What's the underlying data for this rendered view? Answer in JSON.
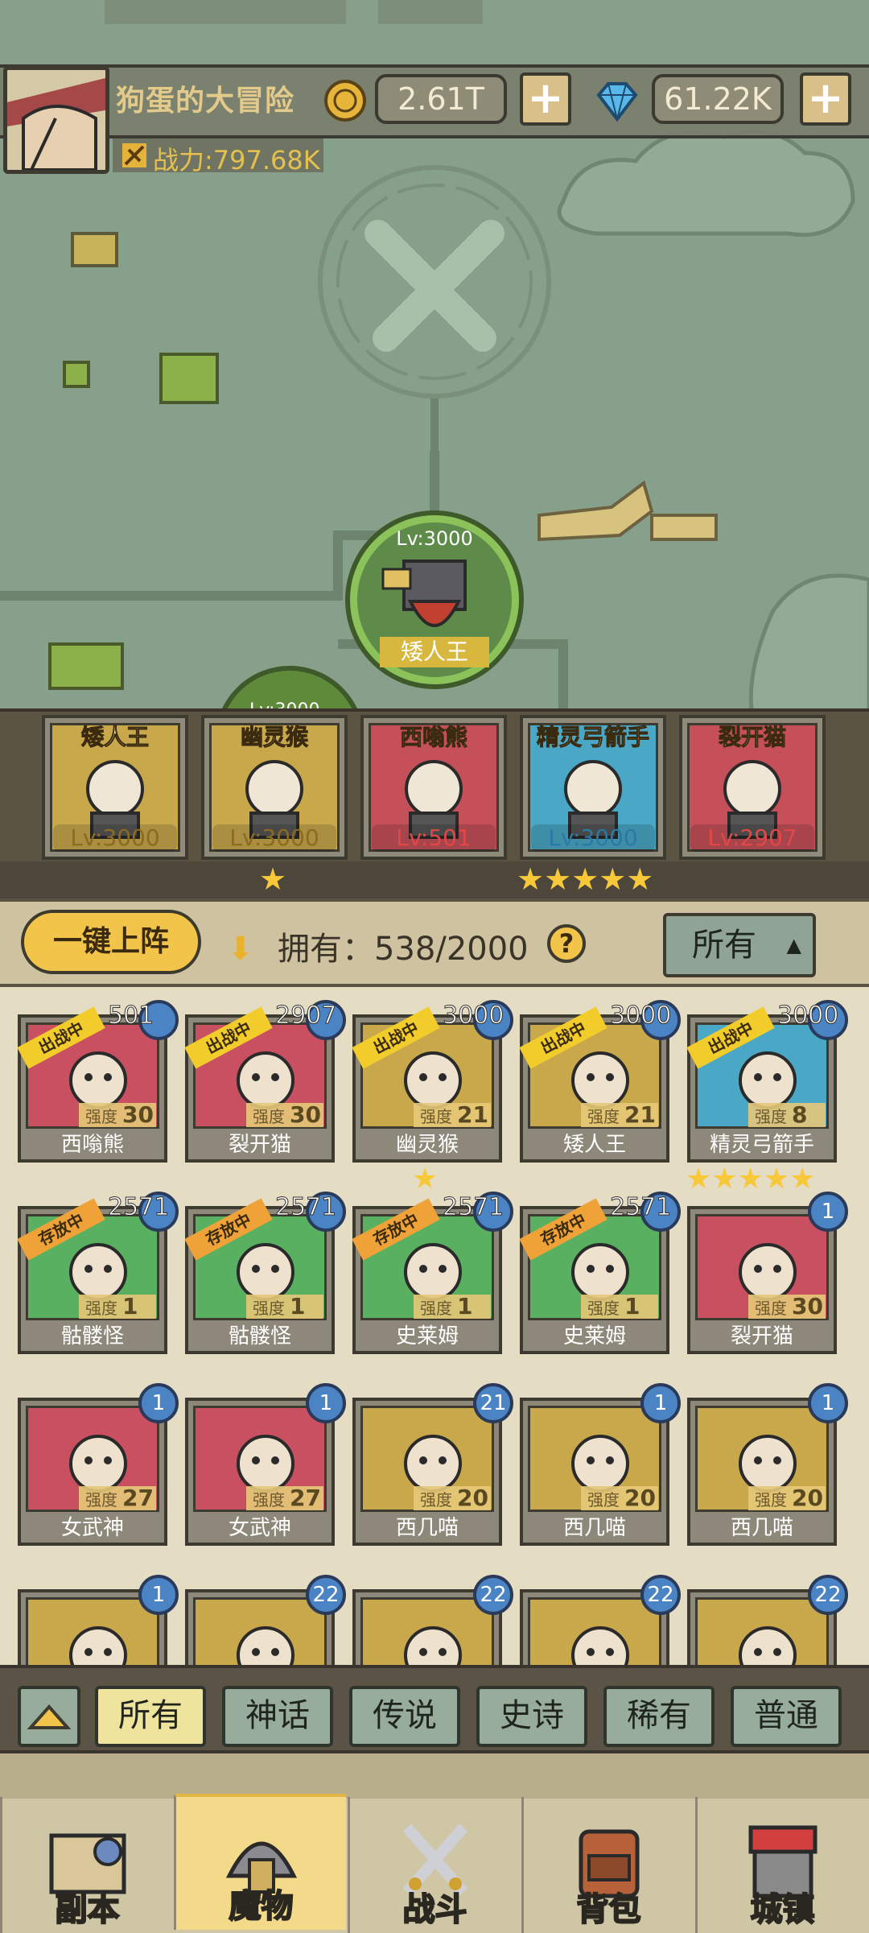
{
  "header": {
    "player_name": "狗蛋的大冒险",
    "gold": "2.61T",
    "gems": "61.22K",
    "power": "战力:797.68K",
    "plus": "+"
  },
  "map": {
    "boss_level": "Lv:3000",
    "boss_name": "矮人王",
    "partial_node_level": "Lv:3000"
  },
  "lineup": [
    {
      "name": "矮人王",
      "level": "Lv:3000",
      "color": "#c9a84c",
      "stars": ""
    },
    {
      "name": "幽灵猴",
      "level": "Lv:3000",
      "color": "#c9a84c",
      "stars": "★"
    },
    {
      "name": "西嗡熊",
      "level": "Lv:501",
      "color": "#c6505a",
      "stars": ""
    },
    {
      "name": "精灵弓箭手",
      "level": "Lv:3000",
      "color": "#4ba7c6",
      "stars": "★★★★★"
    },
    {
      "name": "裂开猫",
      "level": "Lv:2907",
      "color": "#c6505a",
      "stars": ""
    }
  ],
  "toolbar": {
    "one_click": "一键上阵",
    "own_label": "拥有：538/2000",
    "help": "?",
    "filter_all": "所有"
  },
  "grid": [
    {
      "name": "西嗡熊",
      "level": "501",
      "strength": "30",
      "tag": "出战中",
      "color": "#c85060"
    },
    {
      "name": "裂开猫",
      "level": "2907",
      "strength": "30",
      "tag": "出战中",
      "color": "#c85060"
    },
    {
      "name": "幽灵猴",
      "level": "3000",
      "strength": "21",
      "tag": "出战中",
      "color": "#c9a84c",
      "stars": "★"
    },
    {
      "name": "矮人王",
      "level": "3000",
      "strength": "21",
      "tag": "出战中",
      "color": "#c9a84c"
    },
    {
      "name": "精灵弓箭手",
      "level": "3000",
      "strength": "8",
      "tag": "出战中",
      "color": "#4ba7c6",
      "stars": "★★★★★"
    },
    {
      "name": "骷髅怪",
      "level": "2571",
      "strength": "1",
      "tag": "存放中",
      "color": "#58b060"
    },
    {
      "name": "骷髅怪",
      "level": "2571",
      "strength": "1",
      "tag": "存放中",
      "color": "#58b060"
    },
    {
      "name": "史莱姆",
      "level": "2571",
      "strength": "1",
      "tag": "存放中",
      "color": "#58b060"
    },
    {
      "name": "史莱姆",
      "level": "2571",
      "strength": "1",
      "tag": "存放中",
      "color": "#58b060"
    },
    {
      "name": "裂开猫",
      "level": "1",
      "strength": "30",
      "tag": "",
      "color": "#c85060"
    },
    {
      "name": "女武神",
      "level": "1",
      "strength": "27",
      "tag": "",
      "color": "#c85060"
    },
    {
      "name": "女武神",
      "level": "1",
      "strength": "27",
      "tag": "",
      "color": "#c85060"
    },
    {
      "name": "西几喵",
      "level": "21",
      "strength": "20",
      "tag": "",
      "color": "#c9a84c"
    },
    {
      "name": "西几喵",
      "level": "1",
      "strength": "20",
      "tag": "",
      "color": "#c9a84c"
    },
    {
      "name": "西几喵",
      "level": "1",
      "strength": "20",
      "tag": "",
      "color": "#c9a84c"
    },
    {
      "name": "",
      "level": "1",
      "strength": "",
      "tag": "",
      "color": "#c9a84c"
    },
    {
      "name": "",
      "level": "22",
      "strength": "",
      "tag": "",
      "color": "#c9a84c"
    },
    {
      "name": "",
      "level": "22",
      "strength": "",
      "tag": "",
      "color": "#c9a84c"
    },
    {
      "name": "",
      "level": "22",
      "strength": "",
      "tag": "",
      "color": "#c9a84c"
    },
    {
      "name": "",
      "level": "22",
      "strength": "",
      "tag": "",
      "color": "#c9a84c"
    }
  ],
  "strength_label": "强度",
  "rarity_tabs": [
    "所有",
    "神话",
    "传说",
    "史诗",
    "稀有",
    "普通"
  ],
  "nav": [
    {
      "label": "副本",
      "icon": "map-icon"
    },
    {
      "label": "魔物",
      "icon": "helmet-icon"
    },
    {
      "label": "战斗",
      "icon": "swords-icon"
    },
    {
      "label": "背包",
      "icon": "backpack-icon"
    },
    {
      "label": "城镇",
      "icon": "shop-icon"
    }
  ]
}
